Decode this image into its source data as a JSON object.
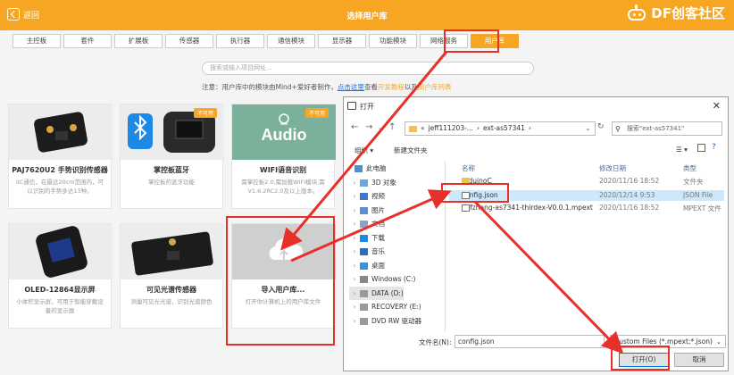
{
  "header": {
    "back_label": "返回",
    "title": "选择用户库",
    "logo_text": "DF创客社区"
  },
  "tabs": [
    "主控板",
    "套件",
    "扩展板",
    "传感器",
    "执行器",
    "通信模块",
    "显示器",
    "功能模块",
    "网络服务",
    "用户库"
  ],
  "active_tab": "用户库",
  "search": {
    "placeholder": "搜索或输入项目网址..."
  },
  "notice": {
    "prefix": "注意：用户库中的模块由Mind+爱好者制作，",
    "link": "点击这里",
    "mid": "查看",
    "dev_tutorial": "开发教程",
    "and": "以及",
    "user_list": "用户库列表"
  },
  "cards": [
    {
      "name": "PAJ7620U2 手势识别传感器",
      "desc": "IIC通信，在最远20cm范围内，可以识别的手势多达13种。",
      "badge": ""
    },
    {
      "name": "掌控板蓝牙",
      "desc": "掌控板的蓝牙功能",
      "badge": "不可用"
    },
    {
      "name": "WIFI语音识别",
      "desc": "需掌控板2.0,需加载WIFI模块,需V1.6.2RC2.0及以上版本。",
      "badge": "不可用"
    },
    {
      "name": "OLED-12864显示屏",
      "desc": "小体积显示屏，可用于智能穿戴设备的显示器",
      "badge": ""
    },
    {
      "name": "可见光谱传感器",
      "desc": "测量可见光光谱，识别光谱颜色",
      "badge": ""
    },
    {
      "name": "导入用户库...",
      "desc": "打开你计算机上的用户库文件",
      "badge": ""
    }
  ],
  "card_images": {
    "audio_text": "Audio"
  },
  "dialog": {
    "title": "打开",
    "path": [
      "jeff111203-...",
      "ext-as57341"
    ],
    "search_placeholder": "搜索\"ext-as57341\"",
    "toolbar": {
      "organize": "组织 ▾",
      "new_folder": "新建文件夹"
    },
    "nav_items": [
      {
        "label": "此电脑",
        "level": 0
      },
      {
        "label": "3D 对象",
        "level": 1
      },
      {
        "label": "视频",
        "level": 1
      },
      {
        "label": "图片",
        "level": 1
      },
      {
        "label": "文档",
        "level": 1
      },
      {
        "label": "下载",
        "level": 1
      },
      {
        "label": "音乐",
        "level": 1
      },
      {
        "label": "桌面",
        "level": 1
      },
      {
        "label": "Windows (C:)",
        "level": 1
      },
      {
        "label": "DATA (D:)",
        "level": 1
      },
      {
        "label": "RECOVERY (E:)",
        "level": 1
      },
      {
        "label": "DVD RW 驱动器",
        "level": 1
      }
    ],
    "columns": {
      "name": "名称",
      "date": "修改日期",
      "type": "类型"
    },
    "files": [
      {
        "name": "arduinoC",
        "date": "2020/11/16 18:52",
        "type": "文件夹",
        "icon": "folder-icon"
      },
      {
        "name": "config.json",
        "date": "2020/12/14 9:53",
        "type": "JSON File",
        "icon": "json-file-icon"
      },
      {
        "name": "jeffzhang-as7341-thirdex-V0.0.1.mpext",
        "date": "2020/11/16 18:52",
        "type": "MPEXT 文件",
        "icon": "file-icon"
      }
    ],
    "filename_label": "文件名(N):",
    "filename_value": "config.json",
    "filetype_value": "Custom Files (*.mpext;*.json)",
    "open_button": "打开(O)",
    "cancel_button": "取消"
  },
  "colors": {
    "accent": "#f6a623",
    "highlight": "#e8302a",
    "link": "#1a6fd6"
  }
}
